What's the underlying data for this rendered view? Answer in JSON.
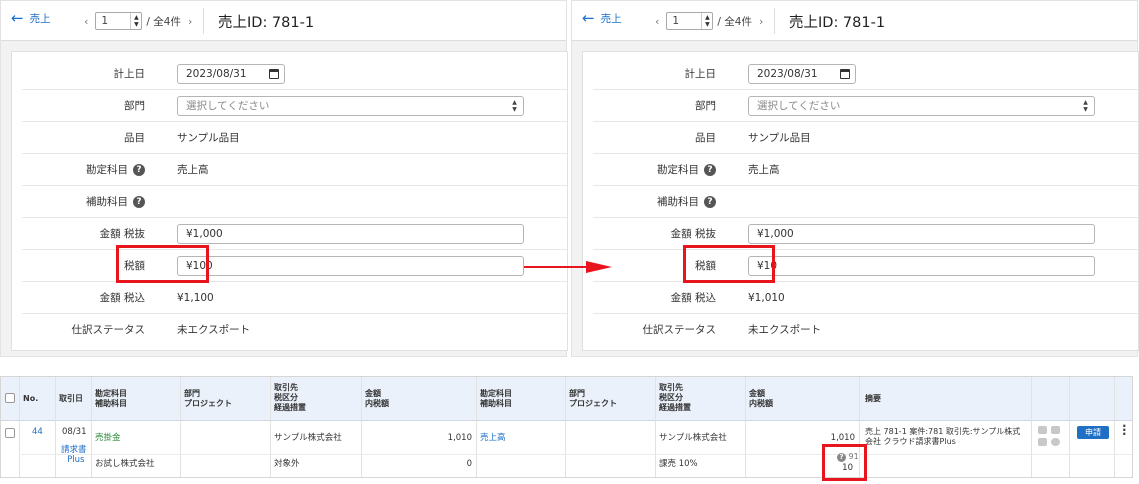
{
  "panels": [
    {
      "back_label": "売上",
      "page_value": "1",
      "page_total": "/ 全4件",
      "record_title": "売上ID: 781-1",
      "fields": {
        "date_label": "計上日",
        "date_value": "2023/08/31",
        "dept_label": "部門",
        "dept_placeholder": "選択してください",
        "item_label": "品目",
        "item_value": "サンプル品目",
        "account_label": "勘定科目",
        "account_value": "売上高",
        "sub_account_label": "補助科目",
        "amount_ex_label": "金額 税抜",
        "amount_ex_value": "¥1,000",
        "tax_label": "税額",
        "tax_value": "¥100",
        "amount_in_label": "金額 税込",
        "amount_in_value": "¥1,100",
        "status_label": "仕訳ステータス",
        "status_value": "未エクスポート"
      }
    },
    {
      "back_label": "売上",
      "page_value": "1",
      "page_total": "/ 全4件",
      "record_title": "売上ID: 781-1",
      "fields": {
        "date_label": "計上日",
        "date_value": "2023/08/31",
        "dept_label": "部門",
        "dept_placeholder": "選択してください",
        "item_label": "品目",
        "item_value": "サンプル品目",
        "account_label": "勘定科目",
        "account_value": "売上高",
        "sub_account_label": "補助科目",
        "amount_ex_label": "金額 税抜",
        "amount_ex_value": "¥1,000",
        "tax_label": "税額",
        "tax_value": "¥10",
        "amount_in_label": "金額 税込",
        "amount_in_value": "¥1,010",
        "status_label": "仕訳ステータス",
        "status_value": "未エクスポート"
      }
    }
  ],
  "ledger": {
    "headers": {
      "no": "No.",
      "date": "取引日",
      "debit_account": [
        "勘定科目",
        "補助科目"
      ],
      "debit_dept": [
        "部門",
        "プロジェクト"
      ],
      "debit_partner": [
        "取引先",
        "税区分",
        "経過措置"
      ],
      "debit_amount": [
        "金額",
        "内税額"
      ],
      "credit_account": [
        "勘定科目",
        "補助科目"
      ],
      "credit_dept": [
        "部門",
        "プロジェクト"
      ],
      "credit_partner": [
        "取引先",
        "税区分",
        "経過措置"
      ],
      "credit_amount": [
        "金額",
        "内税額"
      ],
      "memo": "摘要"
    },
    "row": {
      "no": "44",
      "date": "08/31",
      "source_link": [
        "請求書",
        "Plus"
      ],
      "debit_account": "売掛金",
      "debit_sub_account": "お試し株式会社",
      "debit_partner": "サンプル株式会社",
      "debit_tax_class": "対象外",
      "debit_amount": "1,010",
      "debit_tax": "0",
      "credit_account": "売上高",
      "credit_partner": "サンプル株式会社",
      "credit_tax_class": "課売 10%",
      "credit_amount": "1,010",
      "credit_tax_small": "91",
      "credit_tax": "10",
      "memo": [
        "売上 781-1 案件:781 取引先:サンプル株式",
        "会社 クラウド請求書Plus"
      ],
      "apply_label": "申請"
    }
  },
  "colors": {
    "accent": "#1b6fc9",
    "highlight": "#e8141e",
    "apply": "#1f6fc4"
  }
}
